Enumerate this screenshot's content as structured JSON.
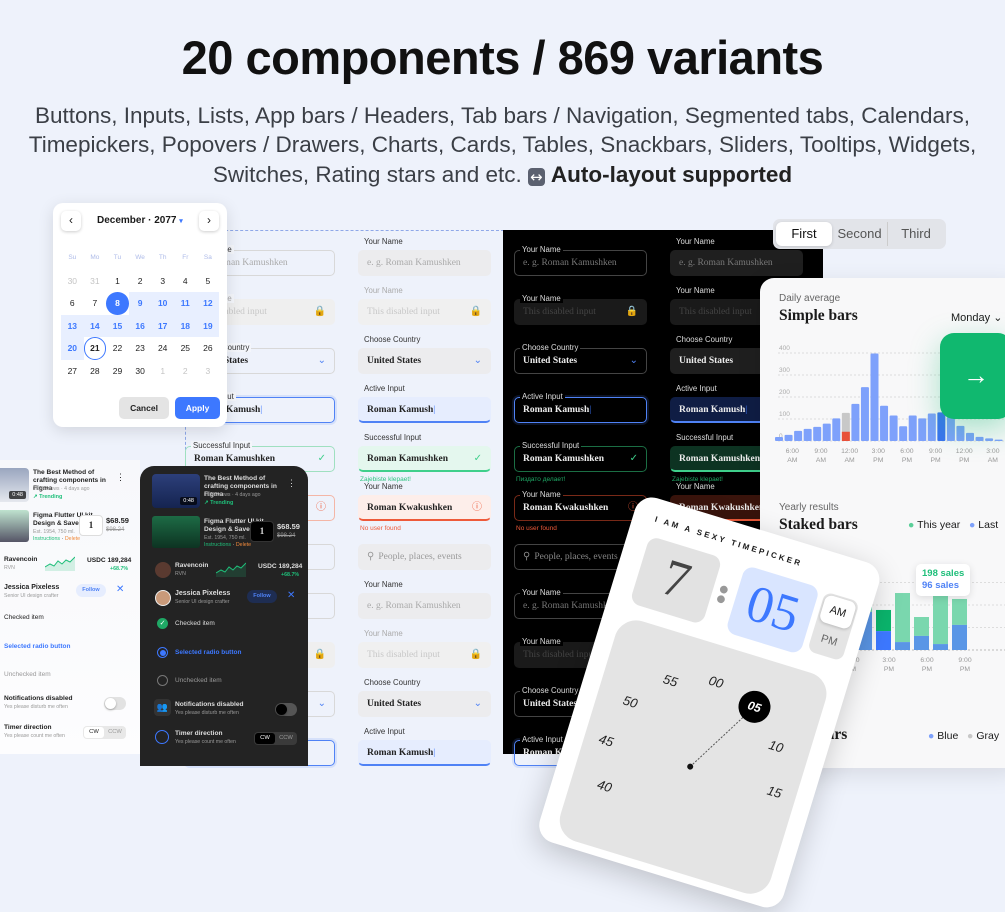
{
  "header": {
    "title": "20 components / 869 variants",
    "subtitle_lines": [
      "Buttons, Inputs, Lists, App bars / Headers, Tab bars / Navigation, Segmented tabs, Calendars,",
      "Timepickers, Popovers / Drawers, Charts, Cards, Tables, Snackbars, Sliders, Tooltips, Widgets,",
      "Switches, Rating stars and etc."
    ],
    "autolayout_icon": "left-right-arrow-icon",
    "autolayout_label": "Auto-layout supported"
  },
  "calendar": {
    "month": "December",
    "year": "2077",
    "weekdays": [
      "Su",
      "Mo",
      "Tu",
      "We",
      "Th",
      "Fr",
      "Sa"
    ],
    "days": [
      "30",
      "31",
      "1",
      "2",
      "3",
      "4",
      "5",
      "6",
      "7",
      "8",
      "9",
      "10",
      "11",
      "12",
      "13",
      "14",
      "15",
      "16",
      "17",
      "18",
      "19",
      "20",
      "21",
      "22",
      "23",
      "24",
      "25",
      "26",
      "27",
      "28",
      "29",
      "30",
      "1",
      "2",
      "3"
    ],
    "selected_day": "10",
    "range_end": "22",
    "today": "23",
    "cancel": "Cancel",
    "apply": "Apply",
    "accent": "#3d78ff"
  },
  "inputs": {
    "your_name": "Your Name",
    "name_short": "Name",
    "placeholder": "e. g. Roman Kamushken",
    "prefilled": "Roman Kamushken",
    "disabled": "This disabled input",
    "choose_country": "Choose Country",
    "country": "United States",
    "active_label": "Active Input",
    "active_value": "Roman Kamush",
    "success_label": "Successful Input",
    "success_value": "Roman Kamushken",
    "success_helper": "Zajebiste klepaet!",
    "success_helper_ru": "Пиздато делает!",
    "error_value": "Roman Kwakushken",
    "error_helper": "No user found",
    "search_placeholder": "People, places, events"
  },
  "segmented": {
    "tabs": [
      "First",
      "Second",
      "Third"
    ],
    "selected": "First"
  },
  "simple_chart": {
    "chart_data": {
      "type": "bar",
      "subtitle": "Daily average",
      "title": "Simple bars",
      "dropdown": "Monday",
      "ylim": [
        0,
        400
      ],
      "yticks": [
        "0",
        "100",
        "200",
        "300",
        "400"
      ],
      "xticks": [
        "6:00 AM",
        "9:00 AM",
        "12:00 AM",
        "3:00 PM",
        "6:00 PM",
        "9:00 PM",
        "12:00 PM",
        "3:00 AM"
      ],
      "values": [
        18,
        28,
        46,
        55,
        64,
        79,
        103,
        128,
        169,
        245,
        398,
        160,
        116,
        67,
        116,
        103,
        125,
        130,
        110,
        69,
        37,
        19,
        12,
        6
      ],
      "highlight_red": {
        "index": 7,
        "value": 42
      },
      "dark_index": 17,
      "grid": true,
      "colors": {
        "bar": "#7ea1fb",
        "gray": "#c8c8c8",
        "red": "#e8503a",
        "dark": "#3b73f0"
      }
    }
  },
  "stacked_chart": {
    "chart_data": {
      "type": "bar",
      "stacked": true,
      "subtitle": "Yearly results",
      "title": "Staked bars",
      "legend": [
        "This year",
        "Last"
      ],
      "series": [
        {
          "name": "Last",
          "values": [
            60,
            80,
            73,
            173,
            86,
            36,
            64,
            27,
            114
          ]
        },
        {
          "name": "This year",
          "values": [
            140,
            170,
            200,
            159,
            96,
            223,
            86,
            305,
            118
          ]
        }
      ],
      "xticks": [
        "12:00 AM",
        "3:00 PM",
        "6:00 PM",
        "9:00 PM"
      ],
      "tooltip": [
        "198 sales",
        "96 sales"
      ],
      "highlight_index": 4,
      "colors": {
        "green": "#7ad7ae",
        "blue": "#5a96e6",
        "green_hl": "#0bb46c",
        "blue_hl": "#3d78ff"
      }
    }
  },
  "grouped_chart": {
    "title_fragment": "bars",
    "legend": [
      "Blue",
      "Gray"
    ]
  },
  "action_button": {
    "icon": "arrow-right-icon",
    "color": "#10b86f"
  },
  "list": {
    "video_title": "The Best Method of crafting components in Figma",
    "video_meta": "182K views · 4 days ago",
    "video_duration": "0:48",
    "trending": "Trending",
    "product_title": "Figma Flutter UI kit. Design & Save time",
    "product_meta": "Est. 1954, 750 ml.",
    "instructions": "Instructions",
    "delete": "Delete",
    "qty": "1",
    "price": "$68.59",
    "old_price": "$98.24",
    "coin": "Ravencoin",
    "coin_ticker": "RVN",
    "coin_value": "USDC 189,284",
    "coin_change": "+68.7%",
    "person": "Jessica Pixeless",
    "person_role": "Senior UI design crafter",
    "follow": "Follow",
    "checked": "Checked item",
    "radio": "Selected radio button",
    "unchecked": "Unchecked item",
    "notif": "Notifications disabled",
    "notif_sub": "Yes please disturb me often",
    "timer": "Timer direction",
    "timer_sub": "Yes please count me often",
    "cw": "CW",
    "ccw": "CCW"
  },
  "timepicker": {
    "title": "I AM A SEXY TIMEPICKER",
    "hour": "7",
    "minute": "05",
    "am": "AM",
    "pm": "PM",
    "dial": [
      "55",
      "00",
      "05",
      "10",
      "15",
      "40",
      "45",
      "50"
    ],
    "selected": "05"
  }
}
